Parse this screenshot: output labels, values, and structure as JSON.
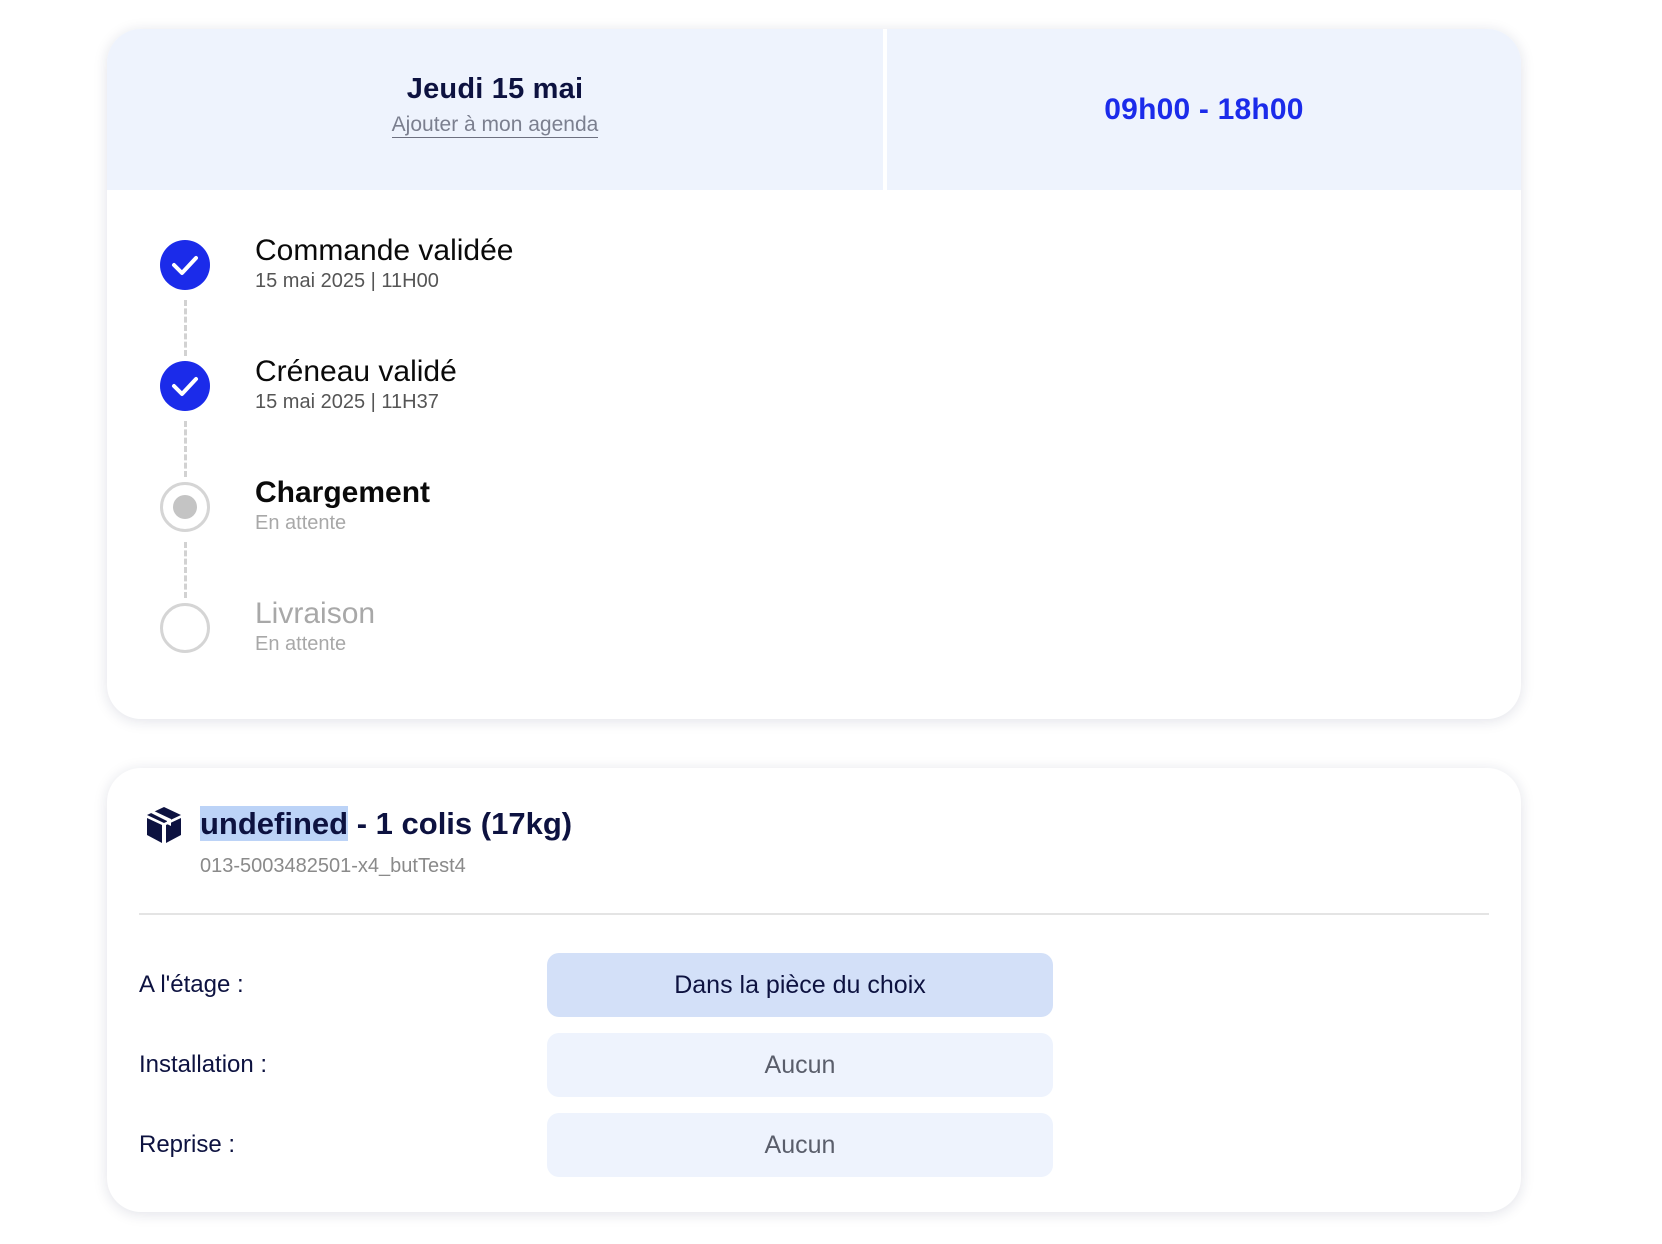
{
  "delivery": {
    "date": "Jeudi 15 mai",
    "add_to_agenda": "Ajouter à mon agenda",
    "time_slot": "09h00 - 18h00"
  },
  "timeline": {
    "steps": [
      {
        "title": "Commande validée",
        "date": "15 mai 2025",
        "time": "11H00",
        "status": "done"
      },
      {
        "title": "Créneau validé",
        "date": "15 mai 2025",
        "time": "11H37",
        "status": "done"
      },
      {
        "title": "Chargement",
        "subtitle": "En attente",
        "status": "current"
      },
      {
        "title": "Livraison",
        "subtitle": "En attente",
        "status": "pending"
      }
    ]
  },
  "parcel": {
    "icon": "package-icon",
    "name": "undefined",
    "summary": " - 1 colis (17kg)",
    "reference": "013-5003482501-x4_butTest4",
    "options": [
      {
        "label": "A l'étage :",
        "value": "Dans la pièce du choix",
        "selected": true
      },
      {
        "label": "Installation :",
        "value": "Aucun",
        "selected": false
      },
      {
        "label": "Reprise :",
        "value": "Aucun",
        "selected": false
      }
    ]
  },
  "colors": {
    "accent": "#1b2bea",
    "header_bg": "#eef3fd",
    "selected_option_bg": "#d3e0f8",
    "text_dark": "#0d1240",
    "muted": "#a8a8a8"
  }
}
